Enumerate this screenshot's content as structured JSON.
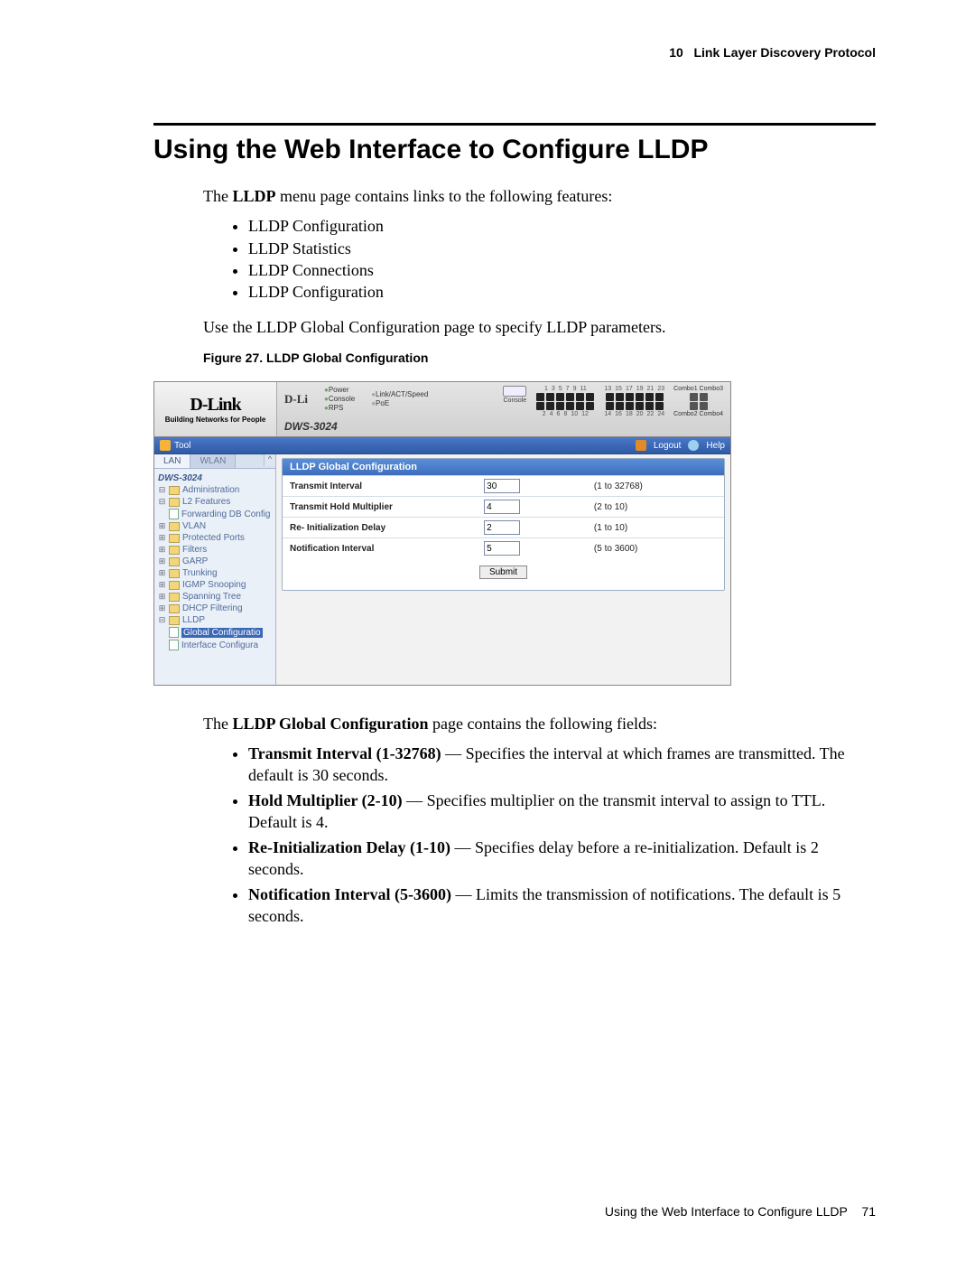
{
  "header": {
    "chapter_num": "10",
    "chapter_title": "Link Layer Discovery Protocol"
  },
  "title": "Using the Web Interface to Configure LLDP",
  "intro": {
    "pre": "The ",
    "bold": "LLDP",
    "post": " menu page contains links to the following features:"
  },
  "features": [
    "LLDP Configuration",
    "LLDP Statistics",
    "LLDP Connections",
    "LLDP Configuration"
  ],
  "usage_line": "Use the LLDP Global Configuration page to specify LLDP parameters.",
  "figure": {
    "label": "Figure 27.",
    "title": "LLDP Global Configuration"
  },
  "shot": {
    "logo": {
      "brand": "D-Link",
      "tagline": "Building Networks for People"
    },
    "device": {
      "brand_echo": "D-Li",
      "leds_a": [
        "Power",
        "Console",
        "RPS"
      ],
      "leds_b": [
        "Link/ACT/Speed",
        "PoE"
      ],
      "model": "DWS-3024",
      "console_lbl": "Console",
      "port_nums_top_a": [
        "1",
        "3",
        "5",
        "7",
        "9",
        "11"
      ],
      "port_nums_top_b": [
        "13",
        "15",
        "17",
        "19",
        "21",
        "23"
      ],
      "port_nums_bot_a": [
        "2",
        "4",
        "6",
        "8",
        "10",
        "12"
      ],
      "port_nums_bot_b": [
        "14",
        "16",
        "18",
        "20",
        "22",
        "24"
      ],
      "combo_top": "Combo1 Combo3",
      "combo_bot": "Combo2 Combo4"
    },
    "toolbar": {
      "tool": "Tool",
      "logout": "Logout",
      "help": "Help"
    },
    "tabs": {
      "lan": "LAN",
      "wlan": "WLAN"
    },
    "tree": {
      "dev": "DWS-3024",
      "admin": "Administration",
      "l2": "L2 Features",
      "fdb": "Forwarding DB Config",
      "vlan": "VLAN",
      "prot": "Protected Ports",
      "filters": "Filters",
      "garp": "GARP",
      "trunk": "Trunking",
      "igmp": "IGMP Snooping",
      "span": "Spanning Tree",
      "dhcp": "DHCP Filtering",
      "lldp": "LLDP",
      "gconf": "Global Configuratio",
      "iconf": "Interface Configura"
    },
    "panel": {
      "title": "LLDP Global Configuration",
      "rows": [
        {
          "label": "Transmit Interval",
          "value": "30",
          "range": "(1 to 32768)"
        },
        {
          "label": "Transmit Hold Multiplier",
          "value": "4",
          "range": "(2 to 10)"
        },
        {
          "label": "Re- Initialization Delay",
          "value": "2",
          "range": "(1 to 10)"
        },
        {
          "label": "Notification Interval",
          "value": "5",
          "range": "(5 to 3600)"
        }
      ],
      "submit": "Submit"
    }
  },
  "after_intro": {
    "pre": "The ",
    "bold": "LLDP Global Configuration",
    "post": " page contains the following fields:"
  },
  "fields": [
    {
      "b": "Transmit Interval (1-32768)",
      "t": " — Specifies the interval at which frames are transmitted. The default is 30 seconds."
    },
    {
      "b": "Hold Multiplier (2-10)",
      "t": " — Specifies multiplier on the transmit interval to assign to TTL. Default is 4."
    },
    {
      "b": "Re-Initialization Delay (1-10)",
      "t": " — Specifies delay before a re-initialization. Default is 2 seconds."
    },
    {
      "b": "Notification Interval (5-3600)",
      "t": " — Limits the transmission of notifications. The default is 5 seconds."
    }
  ],
  "footer": {
    "text": "Using the Web Interface to Configure LLDP",
    "page": "71"
  }
}
